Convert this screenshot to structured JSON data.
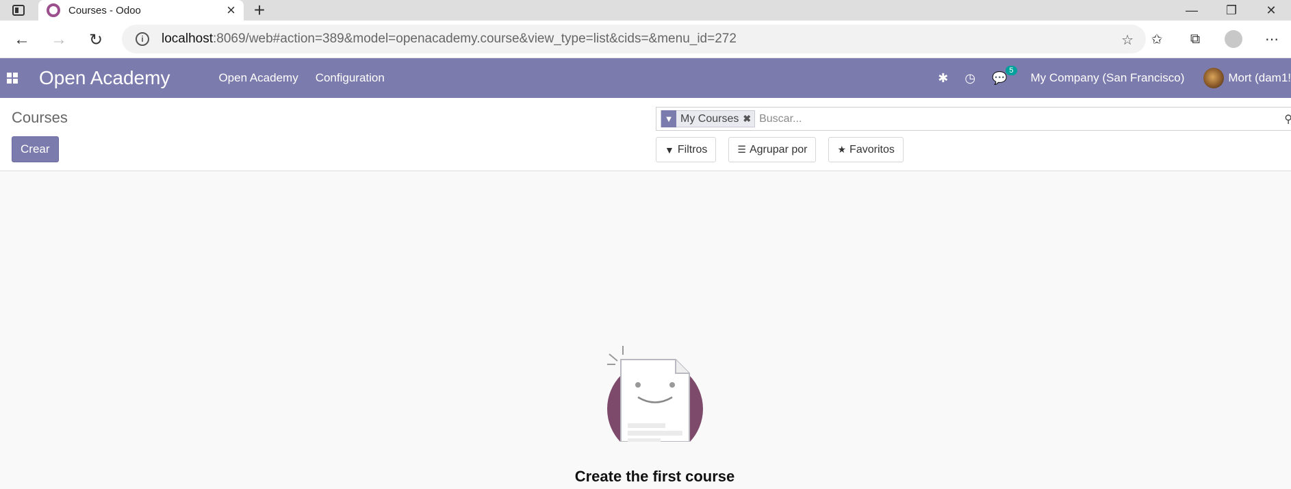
{
  "browser": {
    "tab_title": "Courses - Odoo",
    "url_host": "localhost",
    "url_rest": ":8069/web#action=389&model=openacademy.course&view_type=list&cids=&menu_id=272"
  },
  "navbar": {
    "brand": "Open Academy",
    "menu": [
      "Open Academy",
      "Configuration"
    ],
    "messages_badge": "5",
    "company": "My Company (San Francisco)",
    "user": "Mort (dam1!"
  },
  "control_panel": {
    "breadcrumb": "Courses",
    "create_label": "Crear",
    "facet_label": "My Courses",
    "search_placeholder": "Buscar...",
    "filters_label": "Filtros",
    "groupby_label": "Agrupar por",
    "favorites_label": "Favoritos"
  },
  "empty_state": {
    "title": "Create the first course"
  },
  "colors": {
    "primary": "#7c7bad",
    "accent_badge": "#00a09d",
    "illustration_circle": "#7d4a6b"
  }
}
